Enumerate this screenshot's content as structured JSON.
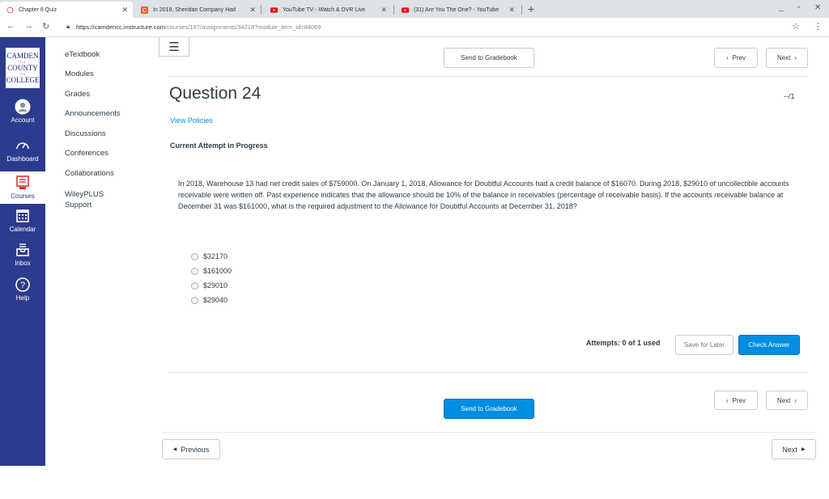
{
  "browser": {
    "tabs": [
      {
        "title": "Chapter 8 Quiz",
        "icon": "spinner-icon"
      },
      {
        "title": "In 2018, Sheridan Company Had",
        "icon": "c-logo-icon"
      },
      {
        "title": "YouTube TV - Watch & DVR Live",
        "icon": "youtube-icon"
      },
      {
        "title": "(31) Are You The One? - YouTube",
        "icon": "youtube-icon"
      }
    ],
    "url_host": "https://camdencc.instructure.com",
    "url_path": "/courses/197/assignments/34218?module_item_id=84069"
  },
  "global_nav": {
    "logo_lines": [
      "CAMDEN",
      "COUNTY",
      "COLLEGE"
    ],
    "items": [
      {
        "label": "Account",
        "icon": "account-icon"
      },
      {
        "label": "Dashboard",
        "icon": "dashboard-icon"
      },
      {
        "label": "Courses",
        "icon": "courses-icon"
      },
      {
        "label": "Calendar",
        "icon": "calendar-icon"
      },
      {
        "label": "Inbox",
        "icon": "inbox-icon"
      },
      {
        "label": "Help",
        "icon": "help-icon"
      }
    ]
  },
  "course_nav": {
    "items": [
      "eTextbook",
      "Modules",
      "Grades",
      "Announcements",
      "Discussions",
      "Conferences",
      "Collaborations",
      "WileyPLUS\nSupport"
    ]
  },
  "header": {
    "send_to_gradebook": "Send to Gradebook",
    "prev": "Prev",
    "next": "Next"
  },
  "question": {
    "title": "Question 24",
    "score": "--/1",
    "view_policies": "View Policies",
    "status": "Current Attempt in Progress",
    "text": "In 2018, Warehouse 13 had net credit sales of $759000. On January 1, 2018, Allowance for Doubtful Accounts had a credit balance of $16070. During 2018, $29010 of uncollectible accounts receivable were written off. Past experience indicates that the allowance should be 10% of the balance in receivables (percentage of receivable basis). If the accounts receivable balance at December 31 was $161000, what is the required adjustment to the Allowance for Doubtful Accounts at December 31, 2018?",
    "options": [
      "$32170",
      "$161000",
      "$29010",
      "$29040"
    ]
  },
  "footer": {
    "attempts": "Attempts: 0 of 1 used",
    "save_for_later": "Save for Later",
    "check_answer": "Check Answer",
    "prev": "Prev",
    "next": "Next",
    "send_to_gradebook": "Send to Gradebook"
  },
  "pager": {
    "previous": "Previous",
    "next": "Next"
  },
  "colors": {
    "nav_bg": "#2d3b8e",
    "primary_button": "#008ee2",
    "link": "#008ee2"
  }
}
